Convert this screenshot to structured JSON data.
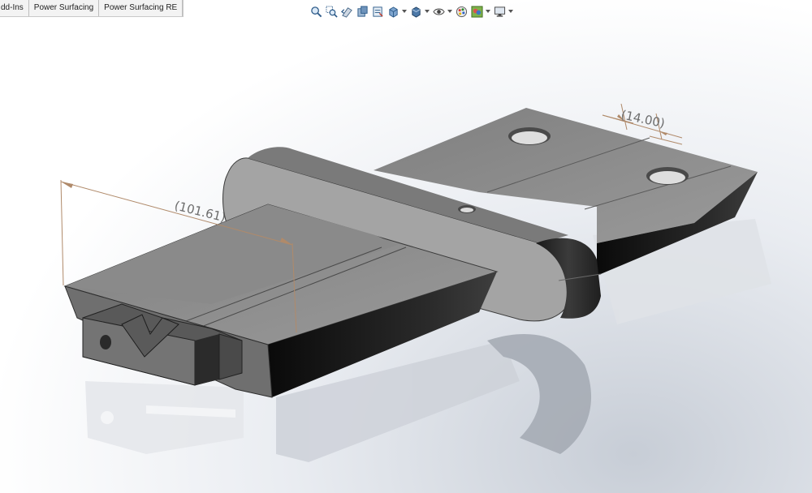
{
  "tabs": [
    {
      "label": "Add-Ins",
      "display": "dd-Ins"
    },
    {
      "label": "Power Surfacing"
    },
    {
      "label": "Power Surfacing RE"
    }
  ],
  "heads_up_toolbar": {
    "icons": [
      "zoom-to-fit-icon",
      "zoom-to-area-icon",
      "previous-view-icon",
      "section-view-icon",
      "dynamic-annotation-view-icon",
      "view-orientation-icon",
      "display-style-icon",
      "hide-show-items-icon",
      "edit-appearance-icon",
      "apply-scene-icon",
      "view-settings-icon"
    ]
  },
  "dimensions": {
    "length": "(101.61)",
    "width": "(14.00)"
  },
  "colors": {
    "part_top": "#8f8f8f",
    "part_side_dark": "#1e1e1e",
    "dimension_line": "#b08a6a",
    "dimension_text": "#6d6d6d"
  }
}
